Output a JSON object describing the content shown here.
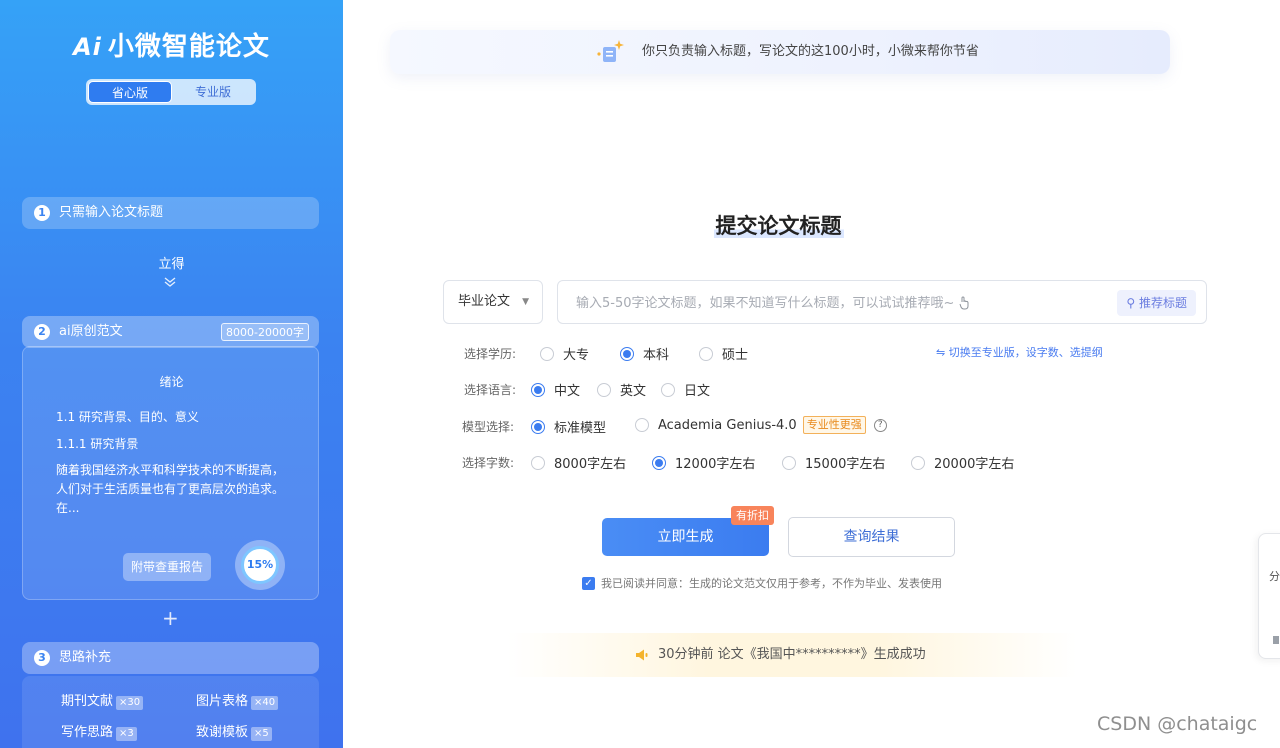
{
  "sidebar": {
    "logo": "Ai",
    "brand": "小微智能论文",
    "modes": [
      "省心版",
      "专业版"
    ],
    "step1": {
      "num": "1",
      "label": "只需输入论文标题"
    },
    "flow_word": "立得",
    "step2": {
      "num": "2",
      "label": "ai原创范文",
      "badge": "8000-20000字"
    },
    "sample": {
      "heading": "绪论",
      "line1": "1.1 研究背景、目的、意义",
      "line2": "1.1.1 研究背景",
      "para": "随着我国经济水平和科学技术的不断提高，人们对于生活质量也有了更高层次的追求。在..."
    },
    "dup_report": "附带查重报告",
    "dup_percent": "15%",
    "step3": {
      "num": "3",
      "label": "思路补充"
    },
    "extras": [
      {
        "label": "期刊文献",
        "count": "×30"
      },
      {
        "label": "图片表格",
        "count": "×40"
      },
      {
        "label": "写作思路",
        "count": "×3"
      },
      {
        "label": "致谢模板",
        "count": "×5"
      }
    ]
  },
  "main": {
    "banner": "你只负责输入标题，写论文的这100小时，小微来帮你节省",
    "title": "提交论文标题",
    "paper_type": "毕业论文",
    "input_placeholder": "输入5-50字论文标题，如果不知道写什么标题，可以试试推荐哦~",
    "recommend": "推荐标题",
    "switch_pro": "切换至专业版，设字数、选提纲",
    "degree": {
      "label": "选择学历:",
      "options": [
        "大专",
        "本科",
        "硕士"
      ],
      "selected": "本科"
    },
    "language": {
      "label": "选择语言:",
      "options": [
        "中文",
        "英文",
        "日文"
      ],
      "selected": "中文"
    },
    "model": {
      "label": "模型选择:",
      "options": [
        "标准模型",
        "Academia Genius-4.0"
      ],
      "selected": "标准模型",
      "tag": "专业性更强"
    },
    "words": {
      "label": "选择字数:",
      "options": [
        "8000字左右",
        "12000字左右",
        "15000字左右",
        "20000字左右"
      ],
      "selected": "12000字左右"
    },
    "generate": "立即生成",
    "discount": "有折扣",
    "query": "查询结果",
    "agree": "我已阅读并同意：生成的论文范文仅用于参考，不作为毕业、发表使用",
    "notice": "30分钟前 论文《我国中**********》生成成功"
  },
  "side_float": "分",
  "watermark": "CSDN @chataigc",
  "colors": {
    "accent": "#3b7cf0",
    "sidebar_top": "#35a2f7",
    "sidebar_bottom": "#3f72ee",
    "discount": "#f8845b"
  }
}
